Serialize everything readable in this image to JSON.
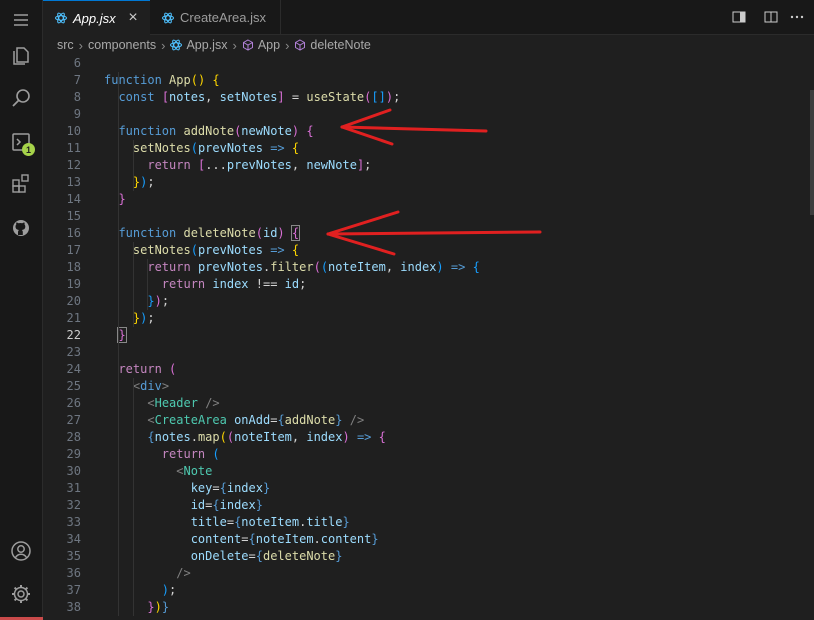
{
  "tabs": [
    {
      "label": "App.jsx",
      "active": true,
      "closable": true
    },
    {
      "label": "CreateArea.jsx",
      "active": false
    }
  ],
  "breadcrumb": [
    "src",
    "components",
    "App.jsx",
    "App",
    "deleteNote"
  ],
  "activity": {
    "items": [
      "menu-icon",
      "explorer-icon",
      "search-icon",
      "run-debug-icon",
      "extensions-icon",
      "github-icon"
    ],
    "badge": "1",
    "bottom": [
      "account-icon",
      "settings-gear-icon"
    ]
  },
  "editor": {
    "active_line": 22,
    "lines": [
      {
        "n": 6,
        "tokens": []
      },
      {
        "n": 7,
        "tokens": [
          [
            "k",
            "function"
          ],
          [
            "o",
            " "
          ],
          [
            "f",
            "App"
          ],
          [
            "p1",
            "()"
          ],
          [
            "o",
            " "
          ],
          [
            "p1",
            "{"
          ]
        ]
      },
      {
        "n": 8,
        "tokens": [
          [
            "o",
            "  "
          ],
          [
            "k",
            "const"
          ],
          [
            "o",
            " "
          ],
          [
            "p2",
            "["
          ],
          [
            "v",
            "notes"
          ],
          [
            "o",
            ", "
          ],
          [
            "v",
            "setNotes"
          ],
          [
            "p2",
            "]"
          ],
          [
            "o",
            " = "
          ],
          [
            "f",
            "useState"
          ],
          [
            "p2",
            "("
          ],
          [
            "p3",
            "[]"
          ],
          [
            "p2",
            ")"
          ],
          [
            "o",
            ";"
          ]
        ]
      },
      {
        "n": 9,
        "tokens": []
      },
      {
        "n": 10,
        "tokens": [
          [
            "o",
            "  "
          ],
          [
            "k",
            "function"
          ],
          [
            "o",
            " "
          ],
          [
            "f",
            "addNote"
          ],
          [
            "p2",
            "("
          ],
          [
            "v",
            "newNote"
          ],
          [
            "p2",
            ")"
          ],
          [
            "o",
            " "
          ],
          [
            "p2",
            "{"
          ]
        ]
      },
      {
        "n": 11,
        "tokens": [
          [
            "o",
            "    "
          ],
          [
            "f",
            "setNotes"
          ],
          [
            "p3",
            "("
          ],
          [
            "v",
            "prevNotes"
          ],
          [
            "o",
            " "
          ],
          [
            "k",
            "=>"
          ],
          [
            "o",
            " "
          ],
          [
            "p1",
            "{"
          ]
        ]
      },
      {
        "n": 12,
        "tokens": [
          [
            "o",
            "      "
          ],
          [
            "c",
            "return"
          ],
          [
            "o",
            " "
          ],
          [
            "p2",
            "["
          ],
          [
            "o",
            "..."
          ],
          [
            "v",
            "prevNotes"
          ],
          [
            "o",
            ", "
          ],
          [
            "v",
            "newNote"
          ],
          [
            "p2",
            "]"
          ],
          [
            "o",
            ";"
          ]
        ]
      },
      {
        "n": 13,
        "tokens": [
          [
            "o",
            "    "
          ],
          [
            "p1",
            "}"
          ],
          [
            "p3",
            ")"
          ],
          [
            "o",
            ";"
          ]
        ]
      },
      {
        "n": 14,
        "tokens": [
          [
            "o",
            "  "
          ],
          [
            "p2",
            "}"
          ]
        ]
      },
      {
        "n": 15,
        "tokens": []
      },
      {
        "n": 16,
        "tokens": [
          [
            "o",
            "  "
          ],
          [
            "k",
            "function"
          ],
          [
            "o",
            " "
          ],
          [
            "f",
            "deleteNote"
          ],
          [
            "p2",
            "("
          ],
          [
            "v",
            "id"
          ],
          [
            "p2",
            ")"
          ],
          [
            "o",
            " "
          ],
          [
            "p2bm",
            "{"
          ]
        ]
      },
      {
        "n": 17,
        "tokens": [
          [
            "o",
            "    "
          ],
          [
            "f",
            "setNotes"
          ],
          [
            "p3",
            "("
          ],
          [
            "v",
            "prevNotes"
          ],
          [
            "o",
            " "
          ],
          [
            "k",
            "=>"
          ],
          [
            "o",
            " "
          ],
          [
            "p1",
            "{"
          ]
        ]
      },
      {
        "n": 18,
        "tokens": [
          [
            "o",
            "      "
          ],
          [
            "c",
            "return"
          ],
          [
            "o",
            " "
          ],
          [
            "v",
            "prevNotes"
          ],
          [
            "o",
            "."
          ],
          [
            "f",
            "filter"
          ],
          [
            "p2",
            "("
          ],
          [
            "p3",
            "("
          ],
          [
            "v",
            "noteItem"
          ],
          [
            "o",
            ", "
          ],
          [
            "v",
            "index"
          ],
          [
            "p3",
            ")"
          ],
          [
            "o",
            " "
          ],
          [
            "k",
            "=>"
          ],
          [
            "o",
            " "
          ],
          [
            "p3",
            "{"
          ]
        ]
      },
      {
        "n": 19,
        "tokens": [
          [
            "o",
            "        "
          ],
          [
            "c",
            "return"
          ],
          [
            "o",
            " "
          ],
          [
            "v",
            "index"
          ],
          [
            "o",
            " !== "
          ],
          [
            "v",
            "id"
          ],
          [
            "o",
            ";"
          ]
        ]
      },
      {
        "n": 20,
        "tokens": [
          [
            "o",
            "      "
          ],
          [
            "p3",
            "}"
          ],
          [
            "p2",
            ")"
          ],
          [
            "o",
            ";"
          ]
        ]
      },
      {
        "n": 21,
        "tokens": [
          [
            "o",
            "    "
          ],
          [
            "p1",
            "}"
          ],
          [
            "p3",
            ")"
          ],
          [
            "o",
            ";"
          ]
        ]
      },
      {
        "n": 22,
        "tokens": [
          [
            "o",
            "  "
          ],
          [
            "p2bm",
            "}"
          ]
        ]
      },
      {
        "n": 23,
        "tokens": []
      },
      {
        "n": 24,
        "tokens": [
          [
            "o",
            "  "
          ],
          [
            "c",
            "return"
          ],
          [
            "o",
            " "
          ],
          [
            "p2",
            "("
          ]
        ]
      },
      {
        "n": 25,
        "tokens": [
          [
            "o",
            "    "
          ],
          [
            "g",
            "<"
          ],
          [
            "t",
            "div"
          ],
          [
            "g",
            ">"
          ]
        ]
      },
      {
        "n": 26,
        "tokens": [
          [
            "o",
            "      "
          ],
          [
            "g",
            "<"
          ],
          [
            "comp",
            "Header"
          ],
          [
            "o",
            " "
          ],
          [
            "g",
            "/>"
          ]
        ]
      },
      {
        "n": 27,
        "tokens": [
          [
            "o",
            "      "
          ],
          [
            "g",
            "<"
          ],
          [
            "comp",
            "CreateArea"
          ],
          [
            "o",
            " "
          ],
          [
            "at",
            "onAdd"
          ],
          [
            "o",
            "="
          ],
          [
            "k",
            "{"
          ],
          [
            "f",
            "addNote"
          ],
          [
            "k",
            "}"
          ],
          [
            "o",
            " "
          ],
          [
            "g",
            "/>"
          ]
        ]
      },
      {
        "n": 28,
        "tokens": [
          [
            "o",
            "      "
          ],
          [
            "k",
            "{"
          ],
          [
            "v",
            "notes"
          ],
          [
            "o",
            "."
          ],
          [
            "f",
            "map"
          ],
          [
            "p1",
            "("
          ],
          [
            "p2",
            "("
          ],
          [
            "v",
            "noteItem"
          ],
          [
            "o",
            ", "
          ],
          [
            "v",
            "index"
          ],
          [
            "p2",
            ")"
          ],
          [
            "o",
            " "
          ],
          [
            "k",
            "=>"
          ],
          [
            "o",
            " "
          ],
          [
            "p2",
            "{"
          ]
        ]
      },
      {
        "n": 29,
        "tokens": [
          [
            "o",
            "        "
          ],
          [
            "c",
            "return"
          ],
          [
            "o",
            " "
          ],
          [
            "p3",
            "("
          ]
        ]
      },
      {
        "n": 30,
        "tokens": [
          [
            "o",
            "          "
          ],
          [
            "g",
            "<"
          ],
          [
            "comp",
            "Note"
          ]
        ]
      },
      {
        "n": 31,
        "tokens": [
          [
            "o",
            "            "
          ],
          [
            "at",
            "key"
          ],
          [
            "o",
            "="
          ],
          [
            "k",
            "{"
          ],
          [
            "v",
            "index"
          ],
          [
            "k",
            "}"
          ]
        ]
      },
      {
        "n": 32,
        "tokens": [
          [
            "o",
            "            "
          ],
          [
            "at",
            "id"
          ],
          [
            "o",
            "="
          ],
          [
            "k",
            "{"
          ],
          [
            "v",
            "index"
          ],
          [
            "k",
            "}"
          ]
        ]
      },
      {
        "n": 33,
        "tokens": [
          [
            "o",
            "            "
          ],
          [
            "at",
            "title"
          ],
          [
            "o",
            "="
          ],
          [
            "k",
            "{"
          ],
          [
            "v",
            "noteItem"
          ],
          [
            "o",
            "."
          ],
          [
            "v",
            "title"
          ],
          [
            "k",
            "}"
          ]
        ]
      },
      {
        "n": 34,
        "tokens": [
          [
            "o",
            "            "
          ],
          [
            "at",
            "content"
          ],
          [
            "o",
            "="
          ],
          [
            "k",
            "{"
          ],
          [
            "v",
            "noteItem"
          ],
          [
            "o",
            "."
          ],
          [
            "v",
            "content"
          ],
          [
            "k",
            "}"
          ]
        ]
      },
      {
        "n": 35,
        "tokens": [
          [
            "o",
            "            "
          ],
          [
            "at",
            "onDelete"
          ],
          [
            "o",
            "="
          ],
          [
            "k",
            "{"
          ],
          [
            "f",
            "deleteNote"
          ],
          [
            "k",
            "}"
          ]
        ]
      },
      {
        "n": 36,
        "tokens": [
          [
            "o",
            "          "
          ],
          [
            "g",
            "/>"
          ]
        ]
      },
      {
        "n": 37,
        "tokens": [
          [
            "o",
            "        "
          ],
          [
            "p3",
            ")"
          ],
          [
            "o",
            ";"
          ]
        ]
      },
      {
        "n": 38,
        "tokens": [
          [
            "o",
            "      "
          ],
          [
            "p2",
            "}"
          ],
          [
            "p1",
            ")"
          ],
          [
            "k",
            "}"
          ]
        ]
      }
    ]
  },
  "annotations": {
    "arrow_color": "#e02020"
  },
  "colors": {
    "accent": "#0078d4",
    "editor_bg": "#1f1f1f",
    "sidebar_bg": "#181818"
  }
}
